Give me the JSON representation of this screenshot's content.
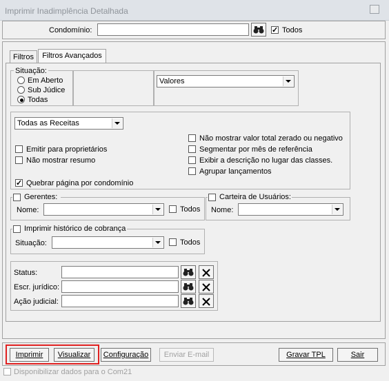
{
  "window": {
    "title": "Imprimir Inadimplência Detalhada"
  },
  "condominio": {
    "label": "Condomínio:",
    "value": "",
    "todos_label": "Todos",
    "todos_checked": true
  },
  "tabs": [
    {
      "label": "Filtros"
    },
    {
      "label": "Filtros Avançados"
    }
  ],
  "situacao": {
    "title": "Situação:",
    "options": [
      {
        "label": "Em Aberto",
        "selected": false
      },
      {
        "label": "Sub Júdice",
        "selected": false
      },
      {
        "label": "Todas",
        "selected": true
      }
    ]
  },
  "valores_select": "Valores",
  "receitas_select": "Todas as Receitas",
  "options_left": [
    {
      "label": "Emitir para proprietários",
      "checked": false
    },
    {
      "label": "Não mostrar resumo",
      "checked": false
    },
    {
      "label": "Quebrar página por condomínio",
      "checked": true
    }
  ],
  "options_right": [
    {
      "label": "Não mostrar valor total zerado ou negativo",
      "checked": false
    },
    {
      "label": "Segmentar por mês de referência",
      "checked": false
    },
    {
      "label": "Exibir a descrição no lugar das classes.",
      "checked": false
    },
    {
      "label": "Agrupar lançamentos",
      "checked": false
    }
  ],
  "gerentes": {
    "title": "Gerentes:",
    "nome_label": "Nome:",
    "nome_value": "",
    "todos_label": "Todos"
  },
  "carteira": {
    "title": "Carteira de Usuários:",
    "nome_label": "Nome:",
    "nome_value": ""
  },
  "historico": {
    "title": "Imprimir histórico de cobrança",
    "situacao_label": "Situação:",
    "situacao_value": "",
    "todos_label": "Todos"
  },
  "filters": [
    {
      "label": "Status:",
      "value": ""
    },
    {
      "label": "Escr. jurídico:",
      "value": ""
    },
    {
      "label": "Ação judicial:",
      "value": ""
    }
  ],
  "buttons": {
    "imprimir": "Imprimir",
    "visualizar": "Visualizar",
    "configuracao": "Configuração",
    "enviar_email": "Enviar E-mail",
    "gravar_tpl": "Gravar TPL",
    "sair": "Sair"
  },
  "footer": {
    "disponibilizar_label": "Disponibilizar dados para o Com21"
  },
  "icons": {
    "find": "binoculars-icon",
    "clear": "x-icon"
  },
  "colors": {
    "highlight": "#e02020",
    "disabled_text": "#a0a0a0"
  }
}
